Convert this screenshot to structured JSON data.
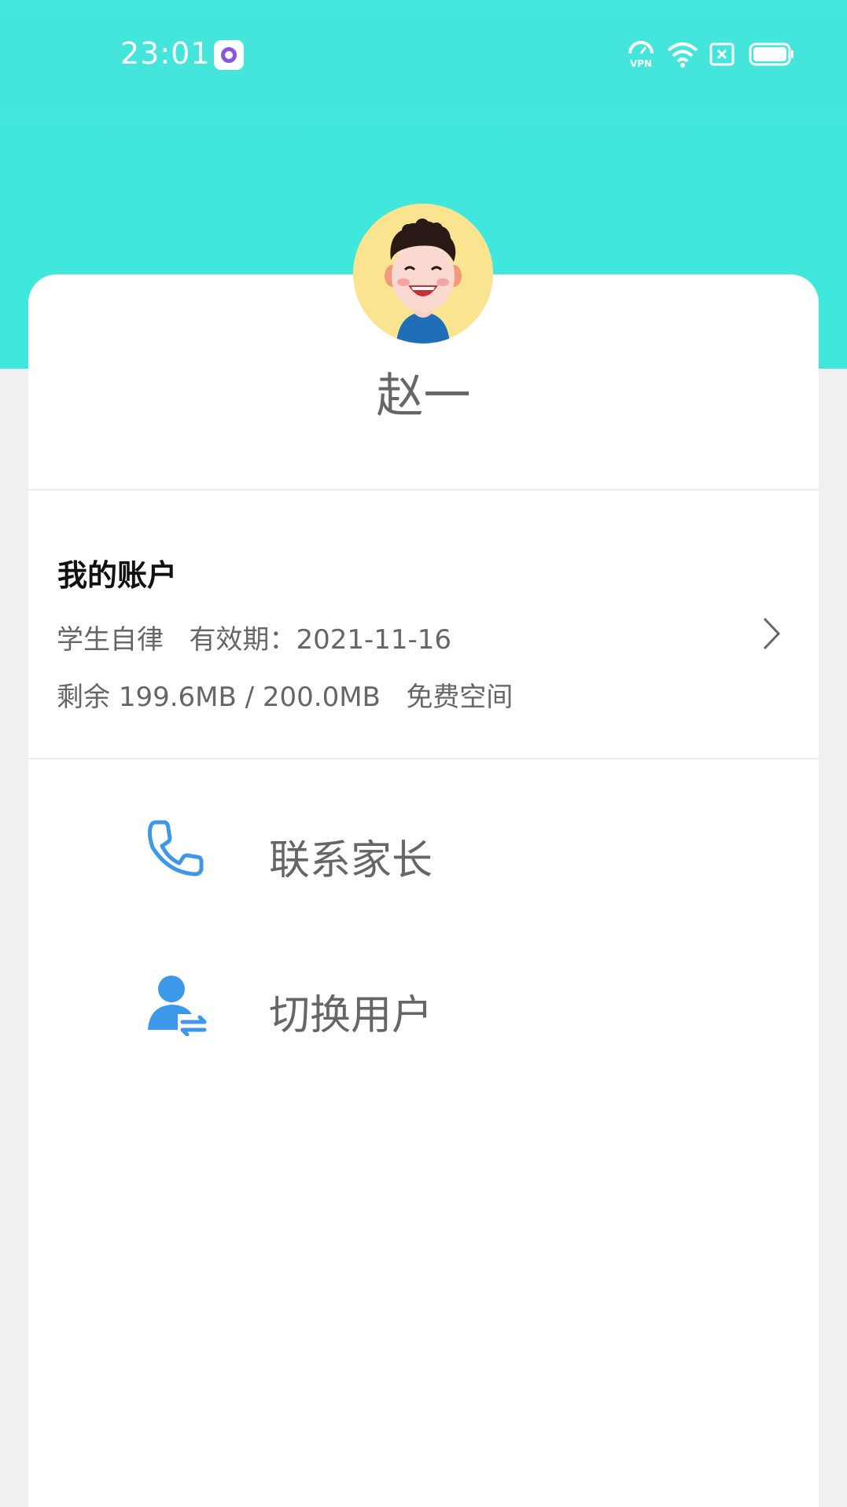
{
  "status_bar": {
    "time": "23:01",
    "icons": [
      "app-notification-icon",
      "vpn-icon",
      "wifi-icon",
      "sim-icon",
      "battery-icon"
    ]
  },
  "colors": {
    "header": "#42E8DC",
    "accent_blue": "#3d98ea",
    "text_gray": "#666666"
  },
  "profile": {
    "name": "赵一",
    "avatar_icon": "cartoon-boy-avatar"
  },
  "account": {
    "title": "我的账户",
    "plan": "学生自律",
    "validity_label": "有效期：",
    "validity_date": "2021-11-16",
    "storage_prefix": "剩余",
    "storage_used": "199.6MB / 200.0MB",
    "storage_type": "免费空间"
  },
  "menu": {
    "items": [
      {
        "label": "联系家长",
        "icon": "phone-icon"
      },
      {
        "label": "切换用户",
        "icon": "switch-user-icon"
      }
    ]
  }
}
